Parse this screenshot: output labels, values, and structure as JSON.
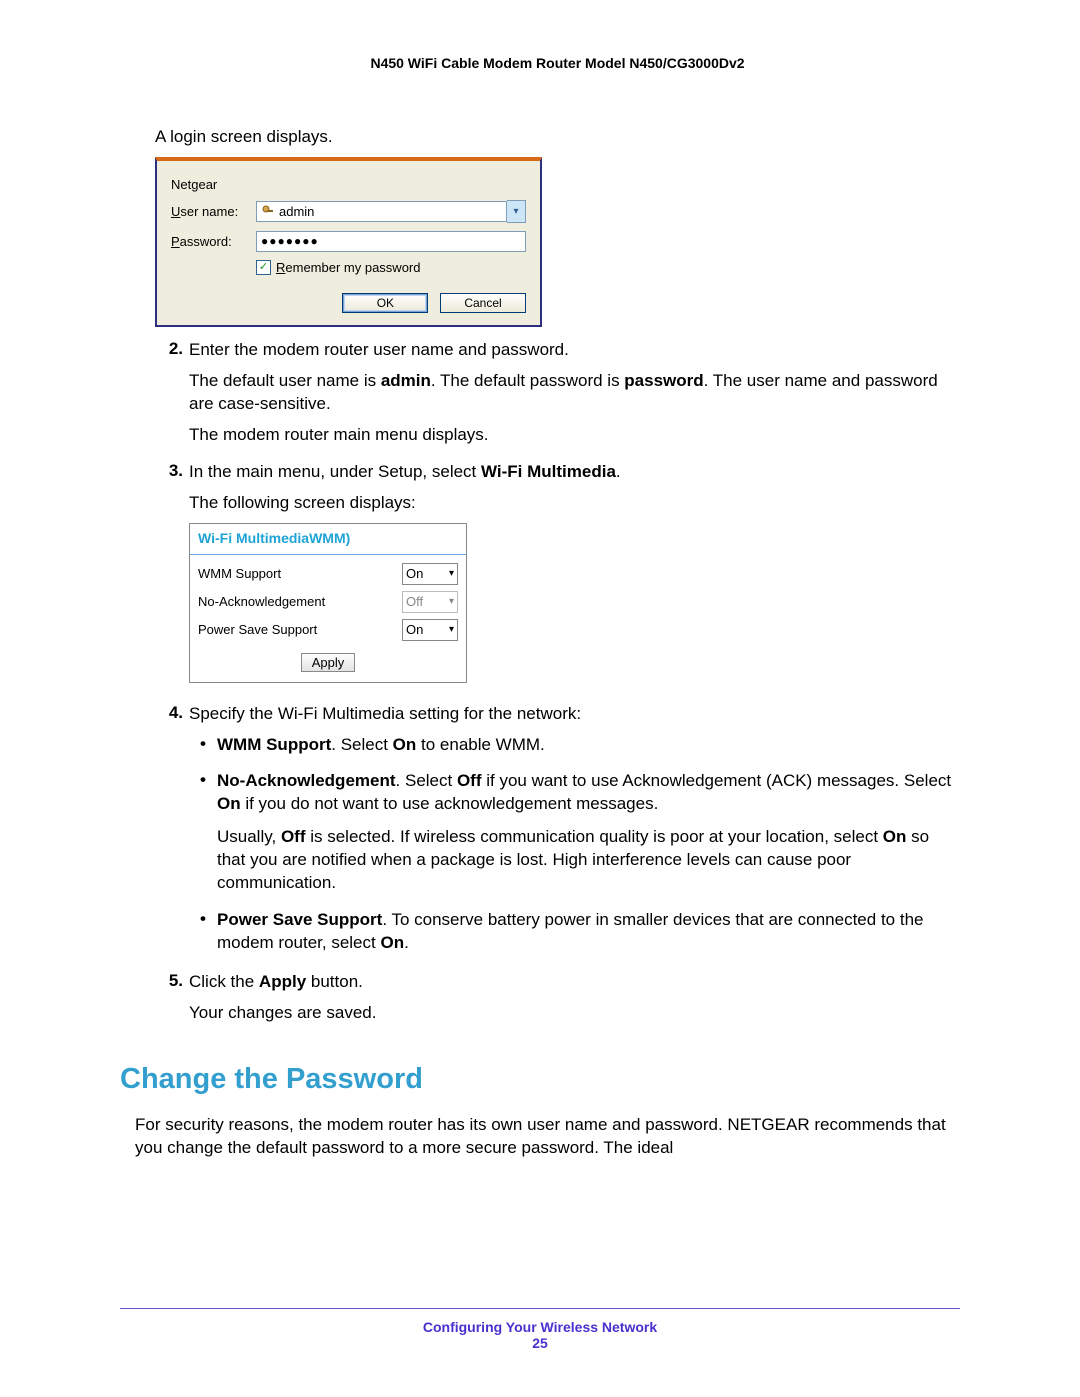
{
  "header": {
    "title": "N450 WiFi Cable Modem Router Model N450/CG3000Dv2"
  },
  "intro_text": "A login screen displays.",
  "login_dialog": {
    "brand": "Netgear",
    "username_label": "User name:",
    "username_value": "admin",
    "password_label": "Password:",
    "password_masked": "●●●●●●●",
    "remember_label": "Remember my password",
    "ok_label": "OK",
    "cancel_label": "Cancel"
  },
  "step2": {
    "num": "2.",
    "line1": "Enter the modem router user name and password.",
    "para2_pre": "The default user name is ",
    "para2_b1": "admin",
    "para2_mid": ". The default password is ",
    "para2_b2": "password",
    "para2_post": ". The user name and password are case-sensitive.",
    "line3": "The modem router main menu displays."
  },
  "step3": {
    "num": "3.",
    "line1_pre": "In the main menu, under Setup, select ",
    "line1_b": "Wi-Fi Multimedia",
    "line1_post": ".",
    "line2": "The following screen displays:"
  },
  "wmm_panel": {
    "title": "Wi-Fi MultimediaWMM)",
    "rows": [
      {
        "label": "WMM Support",
        "value": "On",
        "disabled": false
      },
      {
        "label": "No-Acknowledgement",
        "value": "Off",
        "disabled": true
      },
      {
        "label": "Power Save Support",
        "value": "On",
        "disabled": false
      }
    ],
    "apply_label": "Apply"
  },
  "step4": {
    "num": "4.",
    "intro": "Specify the Wi-Fi Multimedia setting for the network:",
    "b1": {
      "label": "WMM Support",
      "mid": ". Select ",
      "on": "On",
      "post": " to enable WMM."
    },
    "b2": {
      "label": "No-Acknowledgement",
      "mid": ". Select ",
      "off": "Off",
      "text1": " if you want to use Acknowledgement (ACK) messages. Select ",
      "on": "On",
      "text2": " if you do not want to use acknowledgement messages.",
      "para2_pre": "Usually, ",
      "para2_off": "Off",
      "para2_mid": " is selected. If wireless communication quality is poor at your location, select ",
      "para2_on": "On",
      "para2_post": " so that you are notified when a package is lost. High interference levels can cause poor communication."
    },
    "b3": {
      "label": "Power Save Support",
      "text1": ". To conserve battery power in smaller devices that are connected to the modem router, select ",
      "on": "On",
      "post": "."
    }
  },
  "step5": {
    "num": "5.",
    "text_pre": "Click the ",
    "text_b": "Apply",
    "text_post": " button.",
    "line2": "Your changes are saved."
  },
  "section_heading": "Change the Password",
  "section_para": "For security reasons, the modem router has its own user name and password. NETGEAR recommends that you change the default password to a more secure password. The ideal",
  "footer": {
    "chapter": "Configuring Your Wireless Network",
    "page": "25"
  }
}
